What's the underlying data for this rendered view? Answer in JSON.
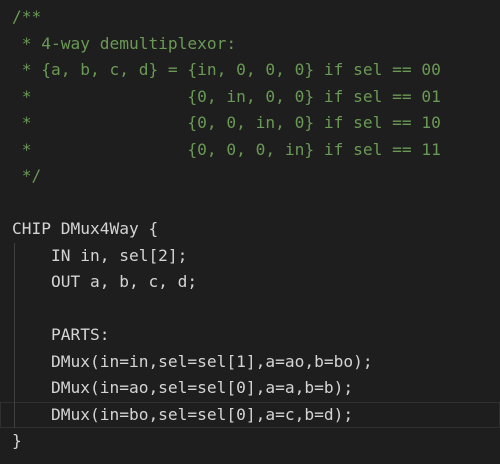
{
  "editor": {
    "lines": [
      {
        "text": "/**",
        "kind": "comment"
      },
      {
        "text": " * 4-way demultiplexor:",
        "kind": "comment"
      },
      {
        "text": " * {a, b, c, d} = {in, 0, 0, 0} if sel == 00",
        "kind": "comment"
      },
      {
        "text": " *                {0, in, 0, 0} if sel == 01",
        "kind": "comment"
      },
      {
        "text": " *                {0, 0, in, 0} if sel == 10",
        "kind": "comment"
      },
      {
        "text": " *                {0, 0, 0, in} if sel == 11",
        "kind": "comment"
      },
      {
        "text": " */",
        "kind": "comment"
      },
      {
        "text": "",
        "kind": "code"
      },
      {
        "text": "CHIP DMux4Way {",
        "kind": "code"
      },
      {
        "text": "    IN in, sel[2];",
        "kind": "code"
      },
      {
        "text": "    OUT a, b, c, d;",
        "kind": "code"
      },
      {
        "text": "",
        "kind": "code"
      },
      {
        "text": "    PARTS:",
        "kind": "code"
      },
      {
        "text": "    DMux(in=in,sel=sel[1],a=ao,b=bo);",
        "kind": "code"
      },
      {
        "text": "    DMux(in=ao,sel=sel[0],a=a,b=b);",
        "kind": "code"
      },
      {
        "text": "    DMux(in=bo,sel=sel[0],a=c,b=d);",
        "kind": "code"
      },
      {
        "text": "}",
        "kind": "code"
      }
    ],
    "colors": {
      "background": "#1e1e1e",
      "text": "#d4d4d4",
      "comment": "#6a9955"
    }
  }
}
